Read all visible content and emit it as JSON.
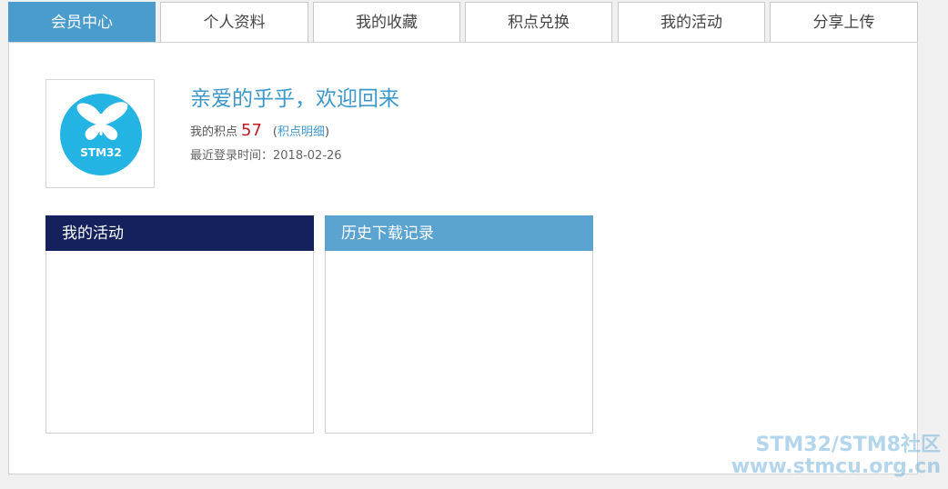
{
  "tabs": [
    {
      "label": "会员中心",
      "active": true
    },
    {
      "label": "个人资料",
      "active": false
    },
    {
      "label": "我的收藏",
      "active": false
    },
    {
      "label": "积点兑换",
      "active": false
    },
    {
      "label": "我的活动",
      "active": false
    },
    {
      "label": "分享上传",
      "active": false
    }
  ],
  "profile": {
    "avatar_logo_text": "STM32",
    "welcome": "亲爱的乎乎，欢迎回来",
    "points_label": "我的积点",
    "points_value": "57",
    "points_open": "(",
    "points_link": "积点明细",
    "points_close": ")",
    "last_login_label": "最近登录时间：",
    "last_login_value": "2018-02-26"
  },
  "boxes": {
    "activity": {
      "title": "我的活动",
      "header_color": "#14215c"
    },
    "downloads": {
      "title": "历史下载记录",
      "header_color": "#5ba3d0"
    }
  },
  "watermark": {
    "line1": "STM32/STM8社区",
    "line2": "www.stmcu.org.cn"
  },
  "colors": {
    "accent": "#4a9ccd",
    "link": "#3d98cc",
    "points": "#c01920",
    "logo_bg": "#23b4e3"
  }
}
